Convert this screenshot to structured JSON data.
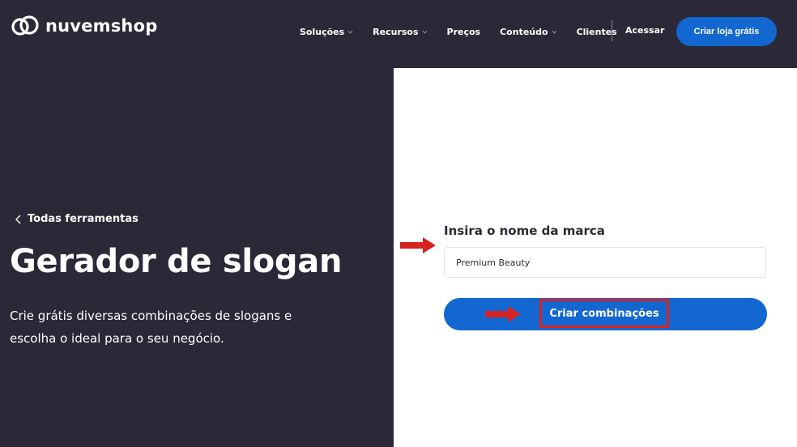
{
  "header": {
    "brand": "nuvemshop",
    "logo_icon": "cloud-rings-logo",
    "nav": [
      {
        "label": "Soluções",
        "has_dropdown": true
      },
      {
        "label": "Recursos",
        "has_dropdown": true
      },
      {
        "label": "Preços",
        "has_dropdown": false
      },
      {
        "label": "Conteúdo",
        "has_dropdown": true
      },
      {
        "label": "Clientes",
        "has_dropdown": false
      }
    ],
    "login_label": "Acessar",
    "cta_label": "Criar loja grátis"
  },
  "hero": {
    "back_label": "Todas ferramentas",
    "title": "Gerador de slogan",
    "description": "Crie grátis diversas combinações de slogans e escolha o ideal para o seu negócio."
  },
  "form": {
    "label": "Insira o nome da marca",
    "input_value": "Premium Beauty",
    "submit_label": "Criar combinações"
  },
  "colors": {
    "background": "#2b2937",
    "accent": "#1367d1",
    "annotation": "#d7231f",
    "panel": "#ffffff"
  },
  "annotations": [
    "red-arrow-icon",
    "red-highlight-box"
  ]
}
